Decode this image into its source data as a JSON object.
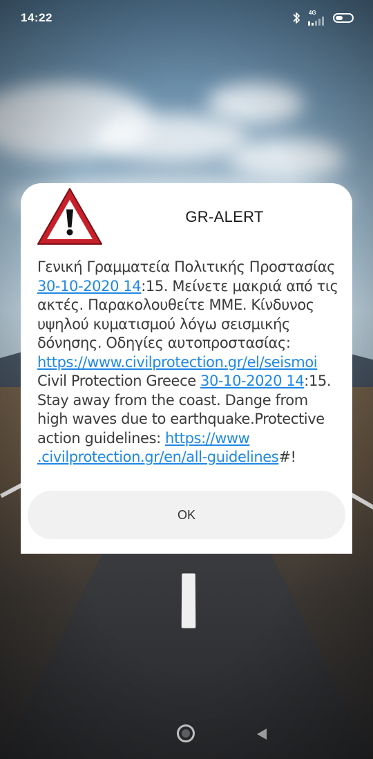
{
  "status_bar": {
    "time": "14:22",
    "network_type": "4G",
    "icons": [
      "bluetooth-icon",
      "signal-icon",
      "battery-icon"
    ]
  },
  "dialog": {
    "icon": "warning-triangle-icon",
    "title": "GR-ALERT",
    "message": {
      "el_prefix": "Γενική Γραμματεία Πολιτικής Προστασίας ",
      "el_datetime": "30-10-2020 14",
      "el_time_suffix": ":15. Μείνετε μακριά από τις ακτές. Παρακολουθείτε ΜΜΕ. Κίνδυνος υψηλού κυματισμού λόγω σεισμικής δόνησης. Οδηγίες αυτοπροστασίας: ",
      "el_link": "https://www.civilprotection.gr/el/seismoi",
      "en_prefix": " Civil Protection Greece ",
      "en_datetime": "30-10-2020 14",
      "en_time_suffix": ":15. Stay away from the coast. Dange from high waves due to earthquake.Protective action guidelines: ",
      "en_link": "https://www .civilprotection.gr/en/all-guidelines",
      "en_suffix": "#!"
    },
    "ok_label": "OK"
  },
  "colors": {
    "link": "#1e88e5",
    "dialog_bg": "#ffffff",
    "button_bg": "#f1f1f1",
    "warning_red": "#c8202a"
  },
  "nav_bar": {
    "icons": [
      "home-icon",
      "back-icon"
    ]
  }
}
